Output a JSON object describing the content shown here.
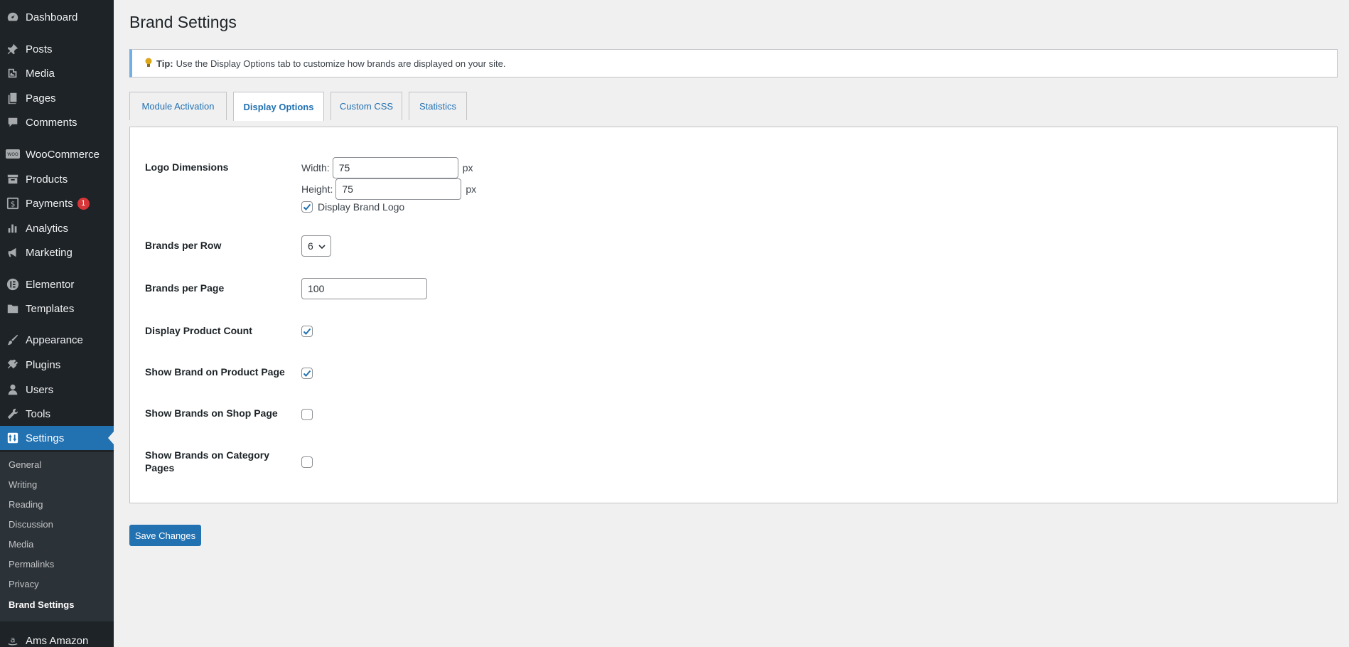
{
  "sidebar": {
    "items": [
      {
        "label": "Dashboard",
        "icon": "dashboard-icon"
      },
      {
        "label": "Posts",
        "icon": "pin-icon"
      },
      {
        "label": "Media",
        "icon": "media-icon"
      },
      {
        "label": "Pages",
        "icon": "pages-icon"
      },
      {
        "label": "Comments",
        "icon": "comment-icon"
      },
      {
        "label": "WooCommerce",
        "icon": "woo-icon"
      },
      {
        "label": "Products",
        "icon": "archive-icon"
      },
      {
        "label": "Payments",
        "icon": "dollar-icon",
        "badge": "1"
      },
      {
        "label": "Analytics",
        "icon": "bar-chart-icon"
      },
      {
        "label": "Marketing",
        "icon": "megaphone-icon"
      },
      {
        "label": "Elementor",
        "icon": "elementor-icon"
      },
      {
        "label": "Templates",
        "icon": "folder-icon"
      },
      {
        "label": "Appearance",
        "icon": "brush-icon"
      },
      {
        "label": "Plugins",
        "icon": "plug-icon"
      },
      {
        "label": "Users",
        "icon": "user-icon"
      },
      {
        "label": "Tools",
        "icon": "wrench-icon"
      },
      {
        "label": "Settings",
        "icon": "settings-icon"
      },
      {
        "label": "Ams Amazon",
        "icon": "amazon-icon"
      }
    ],
    "submenu": [
      "General",
      "Writing",
      "Reading",
      "Discussion",
      "Media",
      "Permalinks",
      "Privacy",
      "Brand Settings"
    ]
  },
  "page": {
    "title": "Brand Settings"
  },
  "notice": {
    "strong": "Tip:",
    "text": "Use the Display Options tab to customize how brands are displayed on your site."
  },
  "tabs": [
    "Module Activation",
    "Display Options",
    "Custom CSS",
    "Statistics"
  ],
  "active_tab": "Display Options",
  "form": {
    "logo_dimensions": {
      "label": "Logo Dimensions",
      "width_label": "Width:",
      "width_value": "75",
      "height_label": "Height:",
      "height_value": "75",
      "unit": "px",
      "display_logo_label": "Display Brand Logo",
      "display_logo_checked": true
    },
    "brands_per_row": {
      "label": "Brands per Row",
      "value": "6"
    },
    "brands_per_page": {
      "label": "Brands per Page",
      "value": "100"
    },
    "display_product_count": {
      "label": "Display Product Count",
      "checked": true
    },
    "show_brand_product_page": {
      "label": "Show Brand on Product Page",
      "checked": true
    },
    "show_brands_shop_page": {
      "label": "Show Brands on Shop Page",
      "checked": false
    },
    "show_brands_category_pages": {
      "label": "Show Brands on Category Pages",
      "checked": false
    }
  },
  "save_label": "Save Changes",
  "colors": {
    "sidebar_bg": "#1d2327",
    "accent": "#2271b1",
    "badge": "#d63638",
    "notice_border": "#72aee6"
  }
}
